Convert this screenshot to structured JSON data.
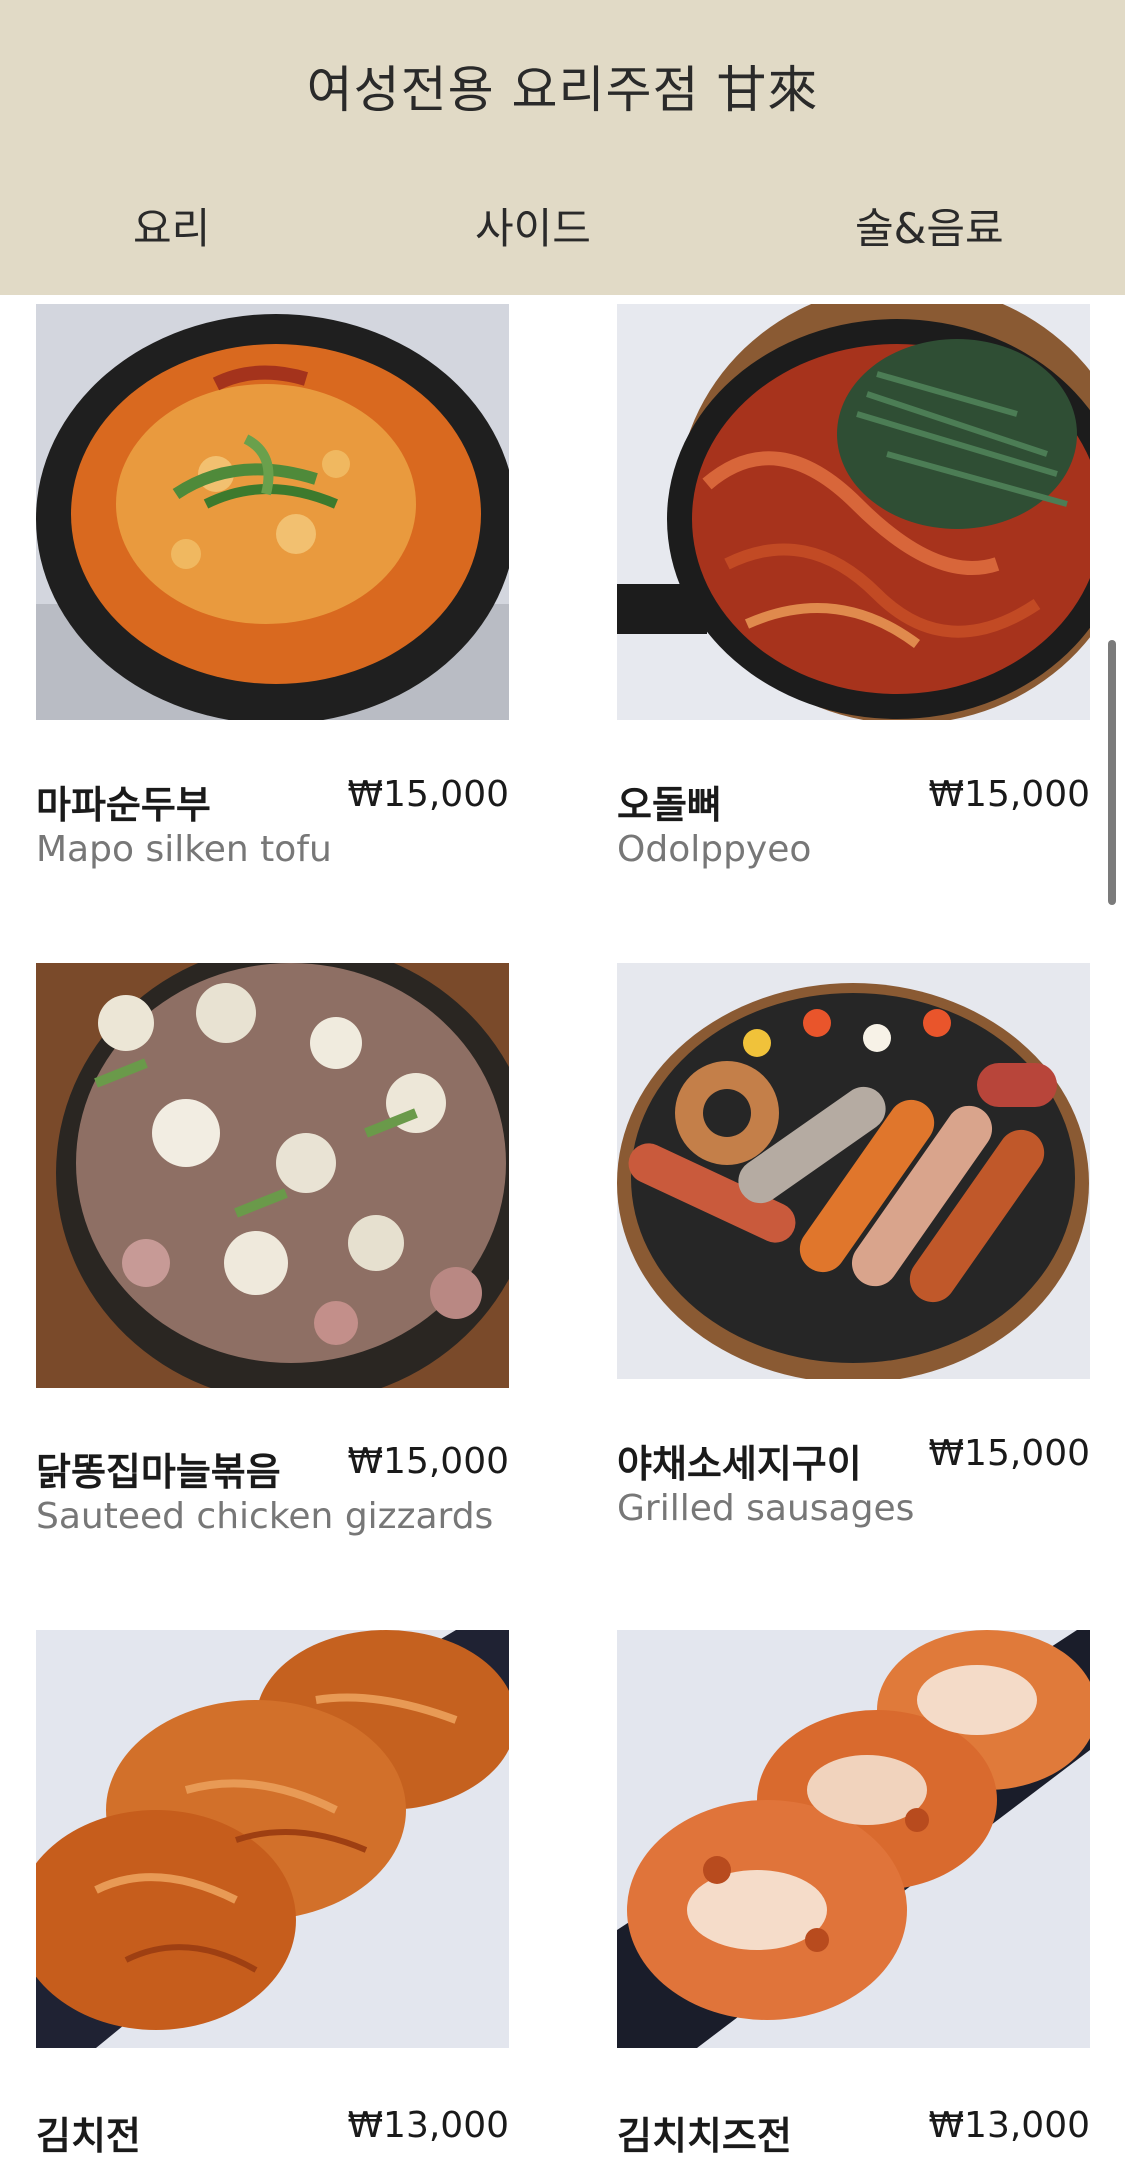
{
  "header": {
    "title": "여성전용 요리주점 甘來",
    "tabs": [
      "요리",
      "사이드",
      "술&음료"
    ]
  },
  "menu": [
    {
      "name": "마파순두부",
      "price": "₩15,000",
      "desc": "Mapo silken tofu",
      "photo_icon": "tofu-stew-photo"
    },
    {
      "name": "오돌뼈",
      "price": "₩15,000",
      "desc": "Odolppyeo",
      "photo_icon": "odolppyeo-photo"
    },
    {
      "name": "닭똥집마늘볶음",
      "price": "₩15,000",
      "desc": "Sauteed chicken gizzards",
      "photo_icon": "gizzards-photo"
    },
    {
      "name": "야채소세지구이",
      "price": "₩15,000",
      "desc": "Grilled sausages",
      "photo_icon": "sausages-photo"
    },
    {
      "name": "김치전",
      "price": "₩13,000",
      "desc": "",
      "photo_icon": "kimchi-pancake-photo"
    },
    {
      "name": "김치치즈전",
      "price": "₩13,000",
      "desc": "",
      "photo_icon": "kimchi-cheese-pancake-photo"
    }
  ],
  "colors": {
    "header_bg": "#e1dac6",
    "price_text": "#1a1a1a",
    "desc_text": "#777777"
  }
}
